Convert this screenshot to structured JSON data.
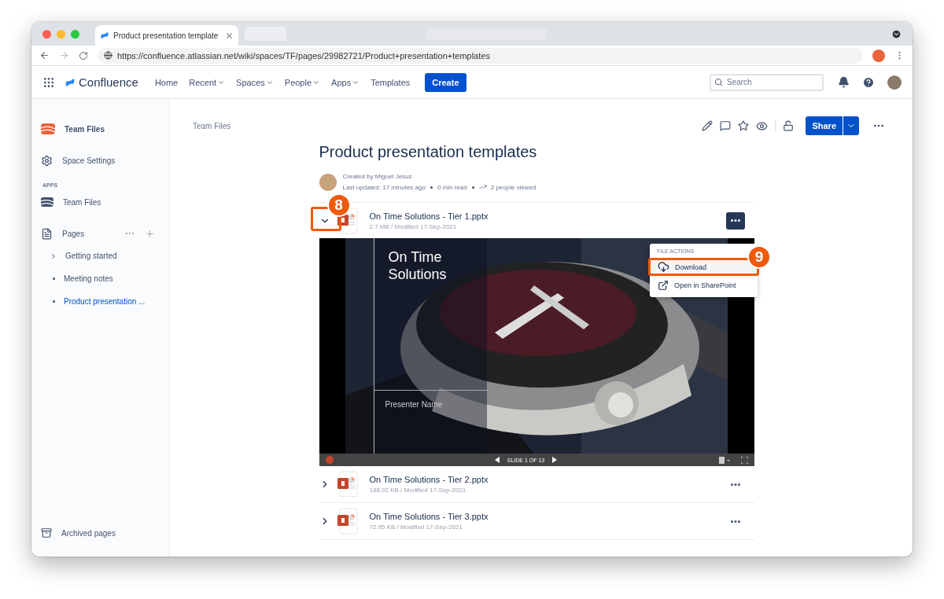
{
  "browser": {
    "tab_title": "Product presentation template",
    "url": "https://confluence.atlassian.net/wiki/spaces/TF/pages/29982721/Product+presentation+templates"
  },
  "nav": {
    "product": "Confluence",
    "items": [
      {
        "label": "Home",
        "dropdown": false
      },
      {
        "label": "Recent",
        "dropdown": true
      },
      {
        "label": "Spaces",
        "dropdown": true
      },
      {
        "label": "People",
        "dropdown": true
      },
      {
        "label": "Apps",
        "dropdown": true
      },
      {
        "label": "Templates",
        "dropdown": false
      }
    ],
    "create": "Create",
    "search": {
      "placeholder": "Search"
    }
  },
  "sidebar": {
    "space": "Team Files",
    "settings": "Space Settings",
    "section": "APPS",
    "app": "Team Files",
    "pages": "Pages",
    "tree": [
      {
        "label": "Getting started",
        "kind": "branch",
        "selected": false
      },
      {
        "label": "Meeting notes",
        "kind": "leaf",
        "selected": false
      },
      {
        "label": "Product presentation ...",
        "kind": "leaf",
        "selected": true
      }
    ],
    "archived": "Archived pages"
  },
  "page": {
    "breadcrumb": "Team Files",
    "share": "Share",
    "title": "Product presentation templates",
    "created": "Created by Miguel Jesus",
    "updated": "Last updated: 17 minutes ago",
    "read": "0 min read",
    "views": "2 people viewed"
  },
  "files": [
    {
      "name": "On Time Solutions - Tier 1.pptx",
      "meta": "2.7 MB / Modified 17-Sep-2021",
      "expanded": true
    },
    {
      "name": "On Time Solutions - Tier 2.pptx",
      "meta": "188.92 KB / Modified 17-Sep-2021",
      "expanded": false
    },
    {
      "name": "On Time Solutions - Tier 3.pptx",
      "meta": "72.95 KB / Modified 17-Sep-2021",
      "expanded": false
    }
  ],
  "slide": {
    "title": "On Time Solutions",
    "presenter": "Presenter Name",
    "counter": "SLIDE 1 OF 13"
  },
  "menu": {
    "heading": "FILE ACTIONS",
    "items": [
      {
        "label": "Download",
        "kind": "download",
        "highlighted": true
      },
      {
        "label": "Open in SharePoint",
        "kind": "open",
        "highlighted": false
      }
    ]
  },
  "annotations": [
    {
      "label": "8"
    },
    {
      "label": "9"
    }
  ]
}
